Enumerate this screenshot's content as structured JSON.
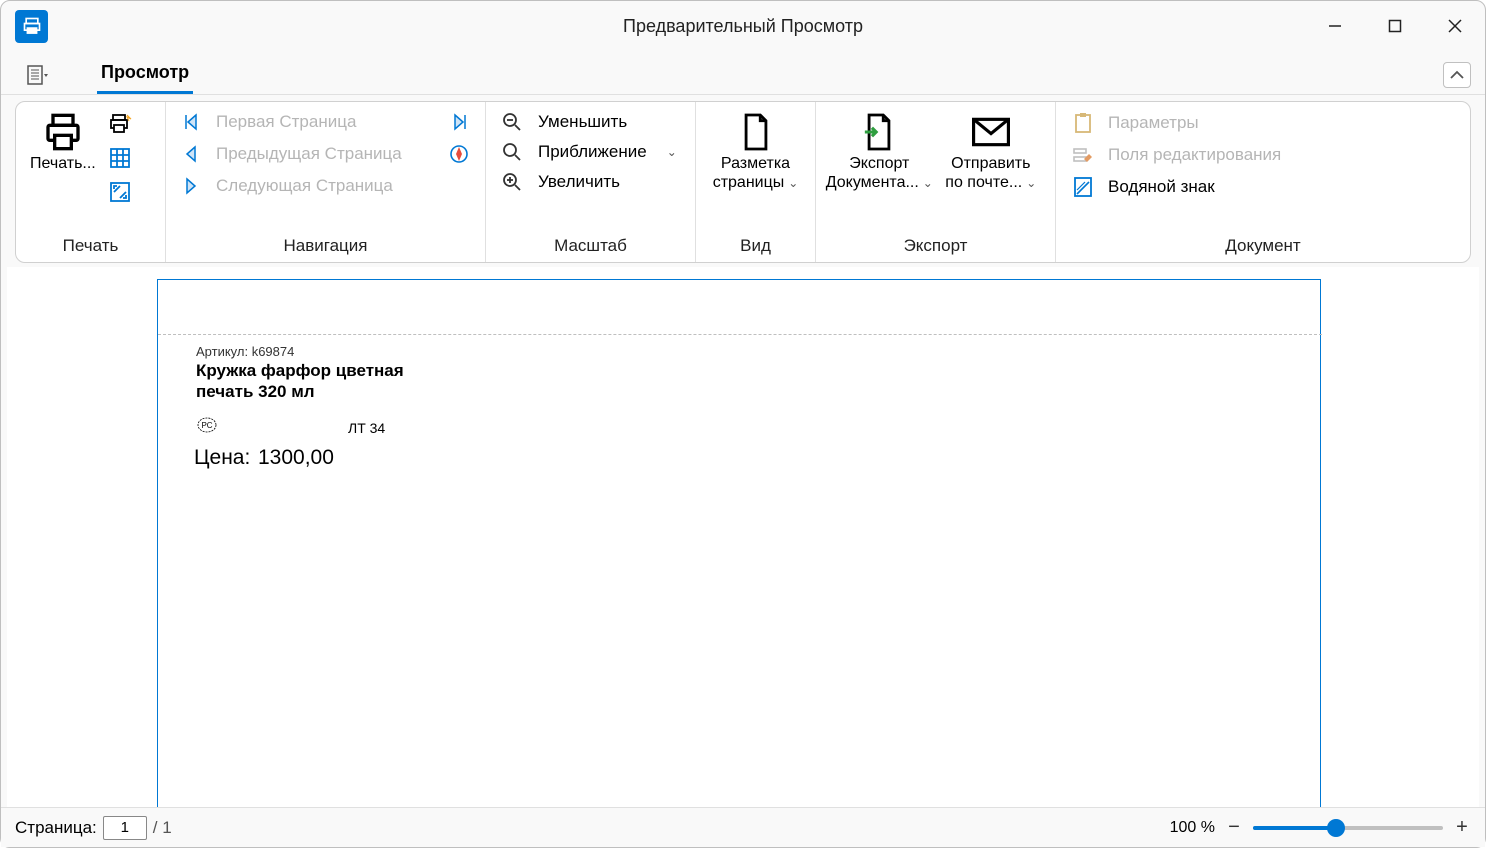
{
  "window": {
    "title": "Предварительный Просмотр"
  },
  "tabs": {
    "active": "Просмотр"
  },
  "ribbon": {
    "print": {
      "group_label": "Печать",
      "print_btn": "Печать..."
    },
    "navigation": {
      "group_label": "Навигация",
      "first_page": "Первая Страница",
      "prev_page": "Предыдущая Страница",
      "next_page": "Следующая Страница"
    },
    "zoom": {
      "group_label": "Масштаб",
      "zoom_out": "Уменьшить",
      "zoom_combo": "Приближение",
      "zoom_in": "Увеличить"
    },
    "view": {
      "group_label": "Вид",
      "page_layout": "Разметка страницы"
    },
    "export": {
      "group_label": "Экспорт",
      "export_doc": "Экспорт Документа...",
      "send_mail": "Отправить по почте..."
    },
    "document": {
      "group_label": "Документ",
      "parameters": "Параметры",
      "edit_fields": "Поля редактирования",
      "watermark": "Водяной знак"
    }
  },
  "document_preview": {
    "sku_line": "Артикул: k69874",
    "product_name": "Кружка фарфор цветная печать 320 мл",
    "lt_label": "ЛТ 34",
    "price_label": "Цена:",
    "price_value": "1300,00"
  },
  "status": {
    "page_label": "Страница:",
    "current_page": "1",
    "total_pages": "/ 1",
    "zoom_text": "100 %"
  }
}
